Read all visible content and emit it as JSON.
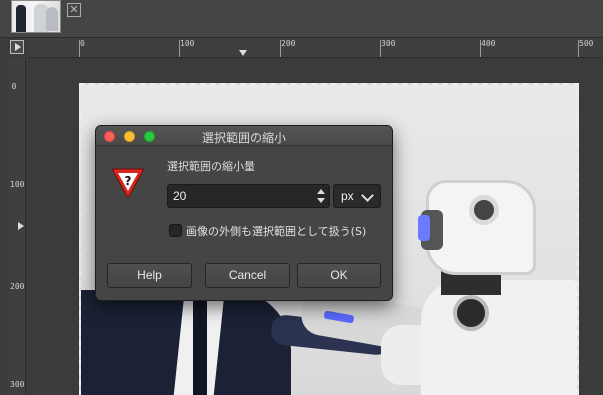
{
  "tab": {
    "close_icon": "close-box-icon",
    "thumbnail_icon": "image-thumbnail"
  },
  "ruler": {
    "horizontal_labels": [
      "0",
      "100",
      "200",
      "300",
      "400",
      "500"
    ],
    "vertical_labels": [
      "0",
      "100",
      "200",
      "300"
    ]
  },
  "dialog": {
    "title": "選択範囲の縮小",
    "icon": "warning-question-icon",
    "section_label": "選択範囲の縮小量",
    "amount_value": "20",
    "unit": "px",
    "checkbox_label": "画像の外側も選択範囲として扱う(S)",
    "checkbox_checked": false,
    "buttons": {
      "help": "Help",
      "cancel": "Cancel",
      "ok": "OK"
    }
  },
  "colors": {
    "close": "#ff5f57",
    "minimize": "#febc2e",
    "zoom": "#28c840",
    "warning_red": "#d7261e"
  }
}
